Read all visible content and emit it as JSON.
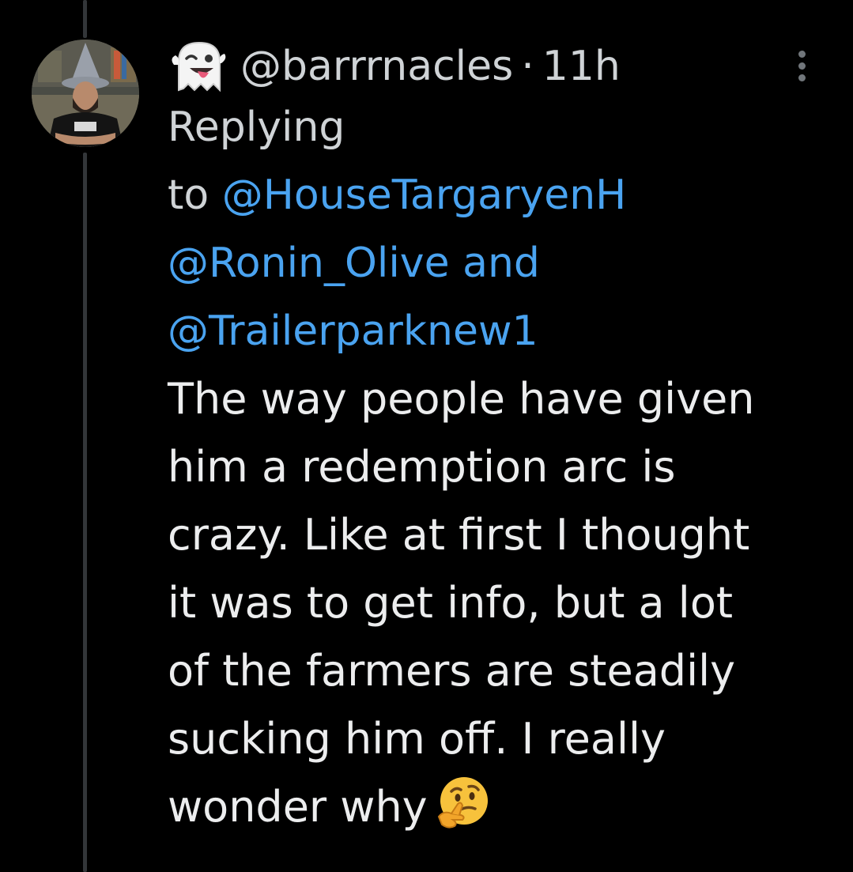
{
  "tweet": {
    "display_name_emoji": "ghost-emoji",
    "handle": "@barrrnacles",
    "separator": "·",
    "time": "11h",
    "reply_prefix_1": "Replying",
    "reply_prefix_2": "to",
    "mentions": [
      "@HouseTargaryenH",
      "@Ronin_Olive",
      "@Trailerparknew1"
    ],
    "mentions_joiner": "and",
    "text_lines": [
      "The way people have given",
      "him a redemption arc is",
      "crazy. Like at first I thought",
      "it was to get info, but a lot",
      "of the farmers are steadily",
      "sucking him off. I really",
      "wonder why"
    ],
    "trailing_emoji": "thinking-face-emoji"
  },
  "colors": {
    "background": "#000000",
    "text": "#e7e9ea",
    "secondary_text": "#cfd3d6",
    "mention": "#4aa3f0",
    "thread_line": "#333639",
    "icon_gray": "#71767b"
  }
}
